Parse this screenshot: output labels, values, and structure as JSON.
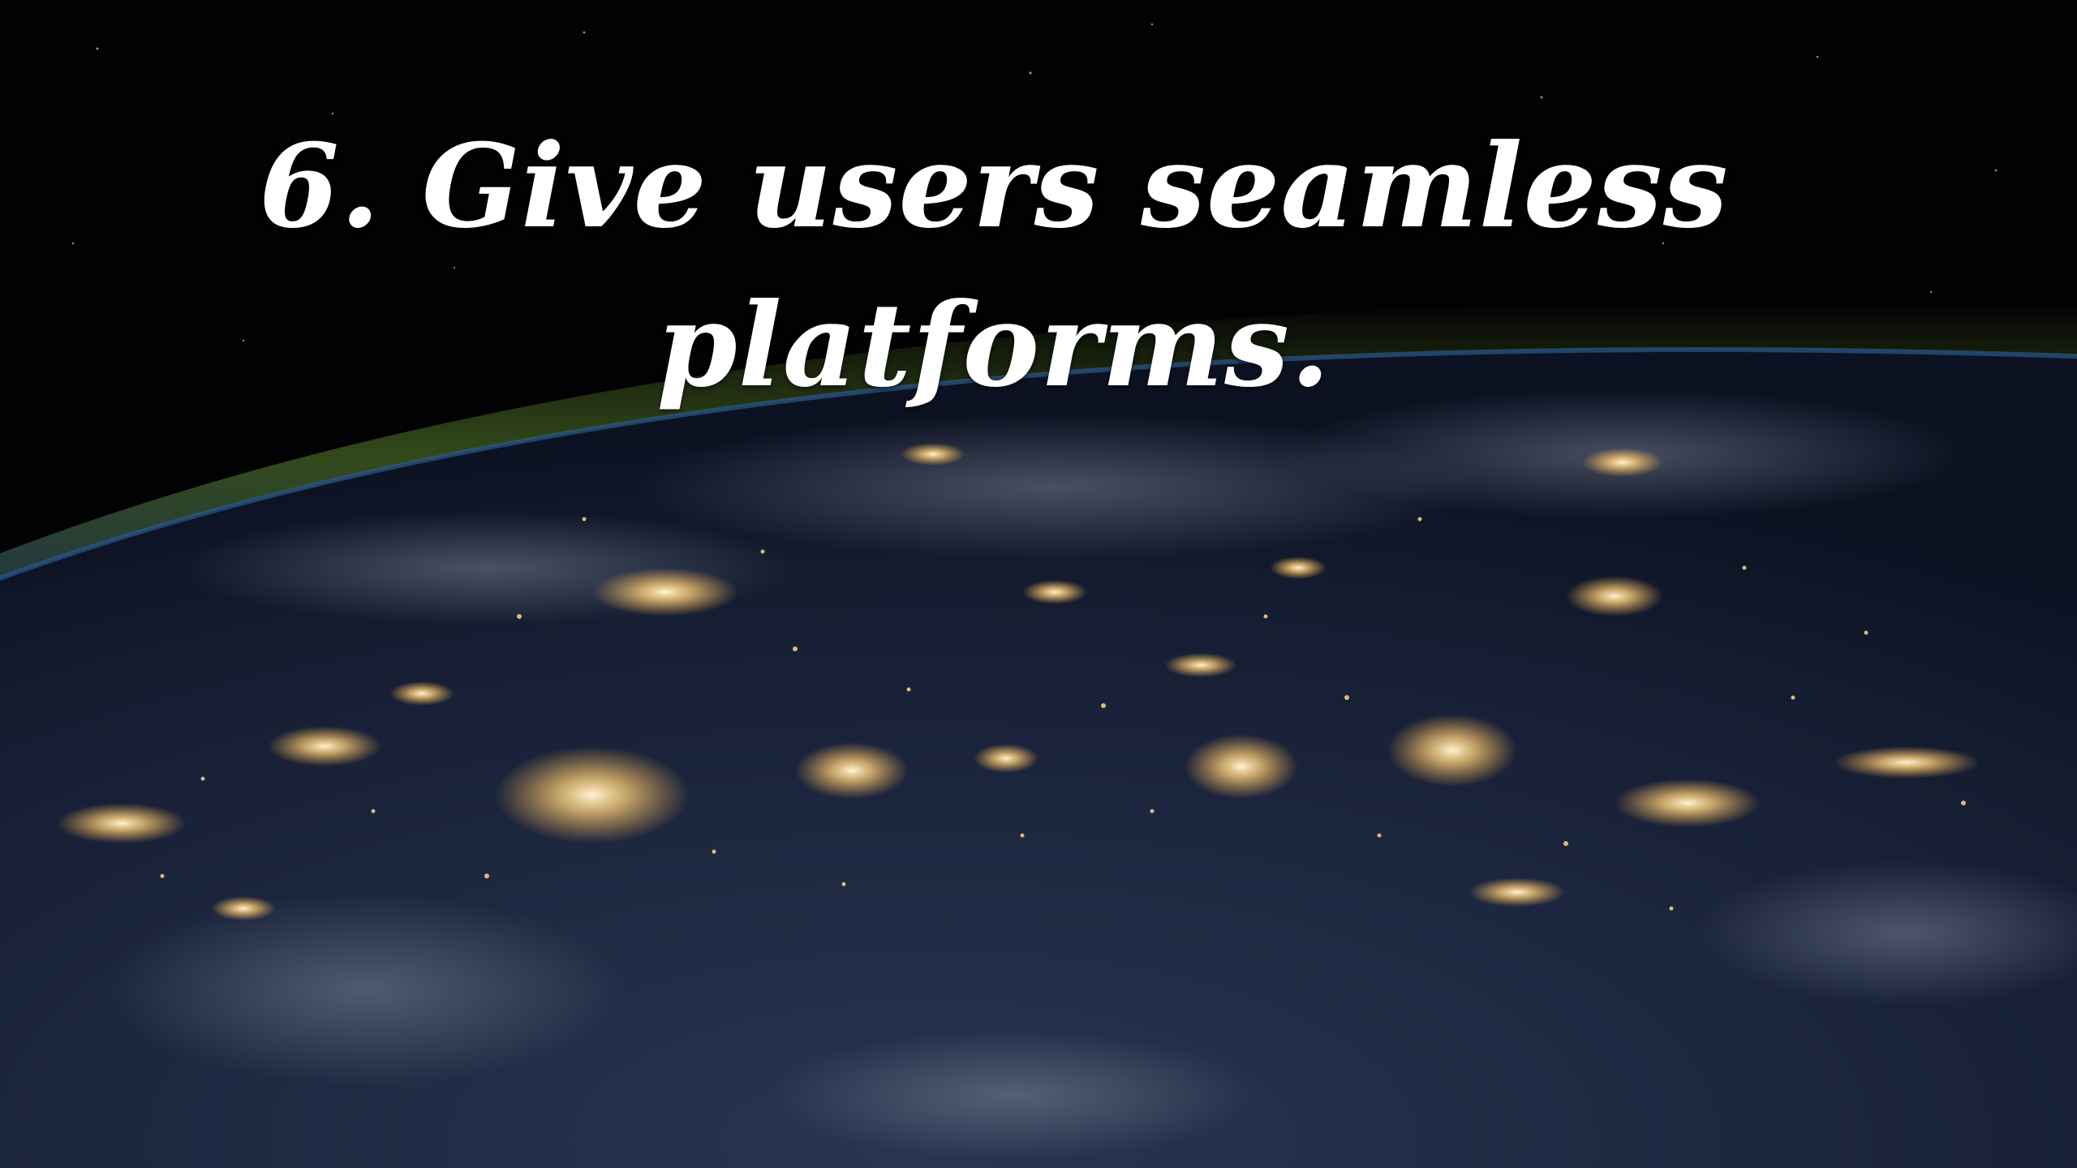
{
  "slide": {
    "title_line_1": "6. Give users seamless",
    "title_line_2": "platforms."
  },
  "background": {
    "subject": "earth-at-night-from-orbit",
    "colors": {
      "space": "#020204",
      "ocean": "#1b2740",
      "atmosphere": "#3e5a1c",
      "city_lights": "#ffd68a",
      "title_text": "#ffffff"
    }
  }
}
